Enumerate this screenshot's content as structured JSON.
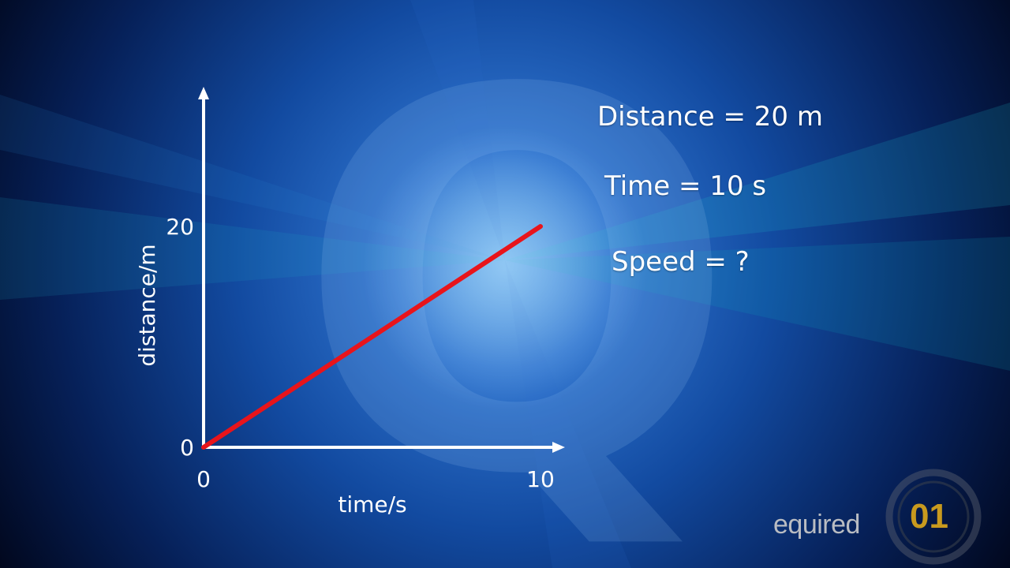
{
  "slide": {
    "lines": [
      "Distance = 20 m",
      "Time = 10 s",
      "Speed = ?"
    ],
    "watermark_letter": "Q",
    "brand": "equired",
    "badge": "01"
  },
  "colors": {
    "background": "#0a2a6e",
    "axis": "#ffffff",
    "line": "#e8141b",
    "badge": "#c89a1e",
    "brand": "#b9bcc2"
  },
  "chart_data": {
    "type": "line",
    "title": "",
    "xlabel": "time/s",
    "ylabel": "distance/m",
    "x_ticks": [
      0,
      10
    ],
    "y_ticks": [
      0,
      20
    ],
    "xlim": [
      0,
      10
    ],
    "ylim": [
      0,
      20
    ],
    "grid": false,
    "series": [
      {
        "x": [
          0,
          10
        ],
        "y": [
          0,
          20
        ]
      }
    ]
  }
}
